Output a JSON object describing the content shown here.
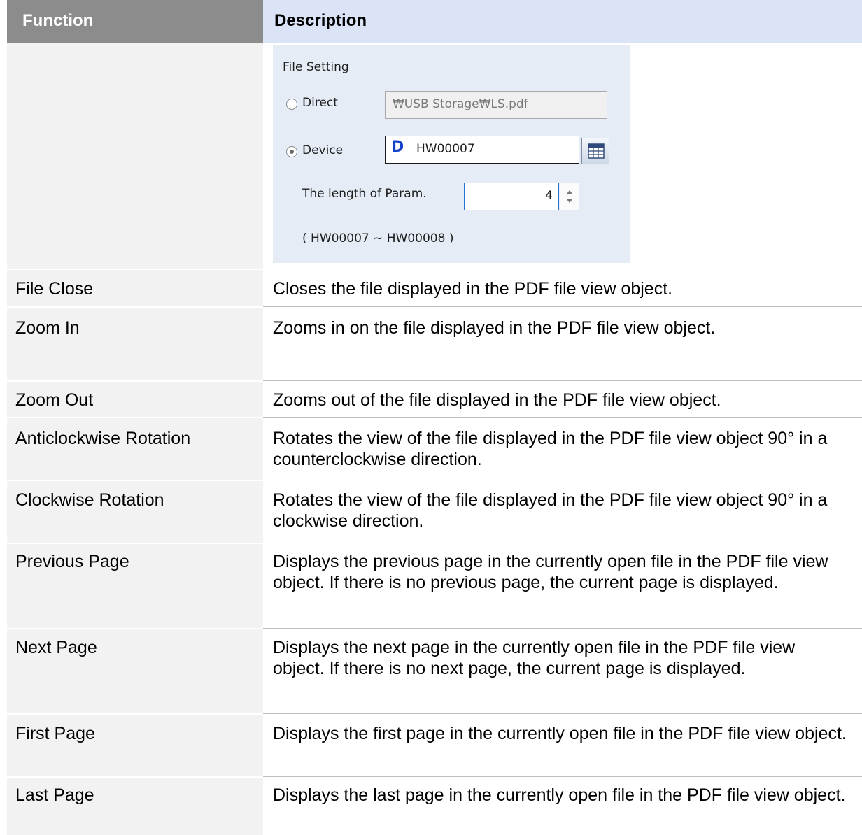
{
  "header": {
    "function": "Function",
    "description": "Description"
  },
  "file_setting": {
    "title": "File Setting",
    "direct_label": "Direct",
    "direct_value": "₩USB Storage₩LS.pdf",
    "device_label": "Device",
    "device_prefix": "D",
    "device_value": "HW00007",
    "device_selected": true,
    "param_label": "The length of Param.",
    "param_value": "4",
    "range": "( HW00007 ~ HW00008 )"
  },
  "rows": [
    {
      "function": "File Close",
      "description": "Closes the file displayed in the PDF file view object."
    },
    {
      "function": "Zoom In",
      "description": "Zooms in on the file displayed in the PDF file view object."
    },
    {
      "function": "Zoom Out",
      "description": "Zooms out of the file displayed in the PDF file view object."
    },
    {
      "function": "Anticlockwise Rotation",
      "description": "Rotates the view of the file displayed in the PDF file view object 90° in a counterclockwise direction."
    },
    {
      "function": "Clockwise Rotation",
      "description": "Rotates the view of the file displayed in the PDF file view object 90° in a clockwise direction."
    },
    {
      "function": "Previous Page",
      "description": "Displays the previous page in the currently open file in the PDF file view object. If there is no previous page, the current page is displayed."
    },
    {
      "function": "Next Page",
      "description": "Displays the next page in the currently open file in the PDF file view object. If there is no next page, the current page is displayed."
    },
    {
      "function": "First Page",
      "description": "Displays the first page in the currently open file in the PDF file view object."
    },
    {
      "function": "Last Page",
      "description": "Displays the last page in the currently open file in the PDF file view object."
    }
  ]
}
